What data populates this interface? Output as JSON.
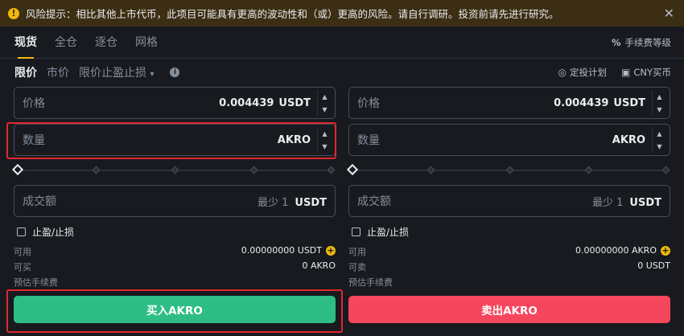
{
  "warning": {
    "icon": "exclamation-icon",
    "text": "风险提示：相比其他上市代币，此项目可能具有更高的波动性和（或）更高的风险。请自行调研。投资前请先进行研究。",
    "close": "✕"
  },
  "tabs": [
    {
      "label": "现货",
      "active": true
    },
    {
      "label": "全仓",
      "active": false
    },
    {
      "label": "逐仓",
      "active": false
    },
    {
      "label": "网格",
      "active": false
    }
  ],
  "fee_level": {
    "icon": "percent-icon",
    "glyph": "%",
    "label": "手续费等级"
  },
  "order_types": {
    "limit": "限价",
    "market": "市价",
    "stop_limit": "限价止盈止损",
    "stop_limit_caret": "▾",
    "info_glyph": "i"
  },
  "links": {
    "auto_invest": "定投计划",
    "auto_invest_glyph": "◎",
    "buy_cny": "CNY买币",
    "buy_cny_glyph": "▣"
  },
  "buy": {
    "price_label": "价格",
    "price_value": "0.004439",
    "price_unit": "USDT",
    "amount_label": "数量",
    "amount_unit": "AKRO",
    "total_label": "成交额",
    "total_min": "最少 1",
    "total_unit": "USDT",
    "tpsl_label": "止盈/止损",
    "available_label": "可用",
    "available_value": "0.00000000 USDT",
    "max_label": "可买",
    "max_value": "0 AKRO",
    "fee_label": "预估手续费",
    "button": "买入AKRO"
  },
  "sell": {
    "price_label": "价格",
    "price_value": "0.004439",
    "price_unit": "USDT",
    "amount_label": "数量",
    "amount_unit": "AKRO",
    "total_label": "成交额",
    "total_min": "最少 1",
    "total_unit": "USDT",
    "tpsl_label": "止盈/止损",
    "available_label": "可用",
    "available_value": "0.00000000 AKRO",
    "max_label": "可卖",
    "max_value": "0 USDT",
    "fee_label": "预估手续费",
    "button": "卖出AKRO"
  },
  "stepper": {
    "up": "▲",
    "down": "▼"
  },
  "plus_glyph": "+",
  "colors": {
    "buy": "#2ebd85",
    "sell": "#f6465d",
    "accent": "#f0b90b",
    "highlight": "#e0282e"
  }
}
